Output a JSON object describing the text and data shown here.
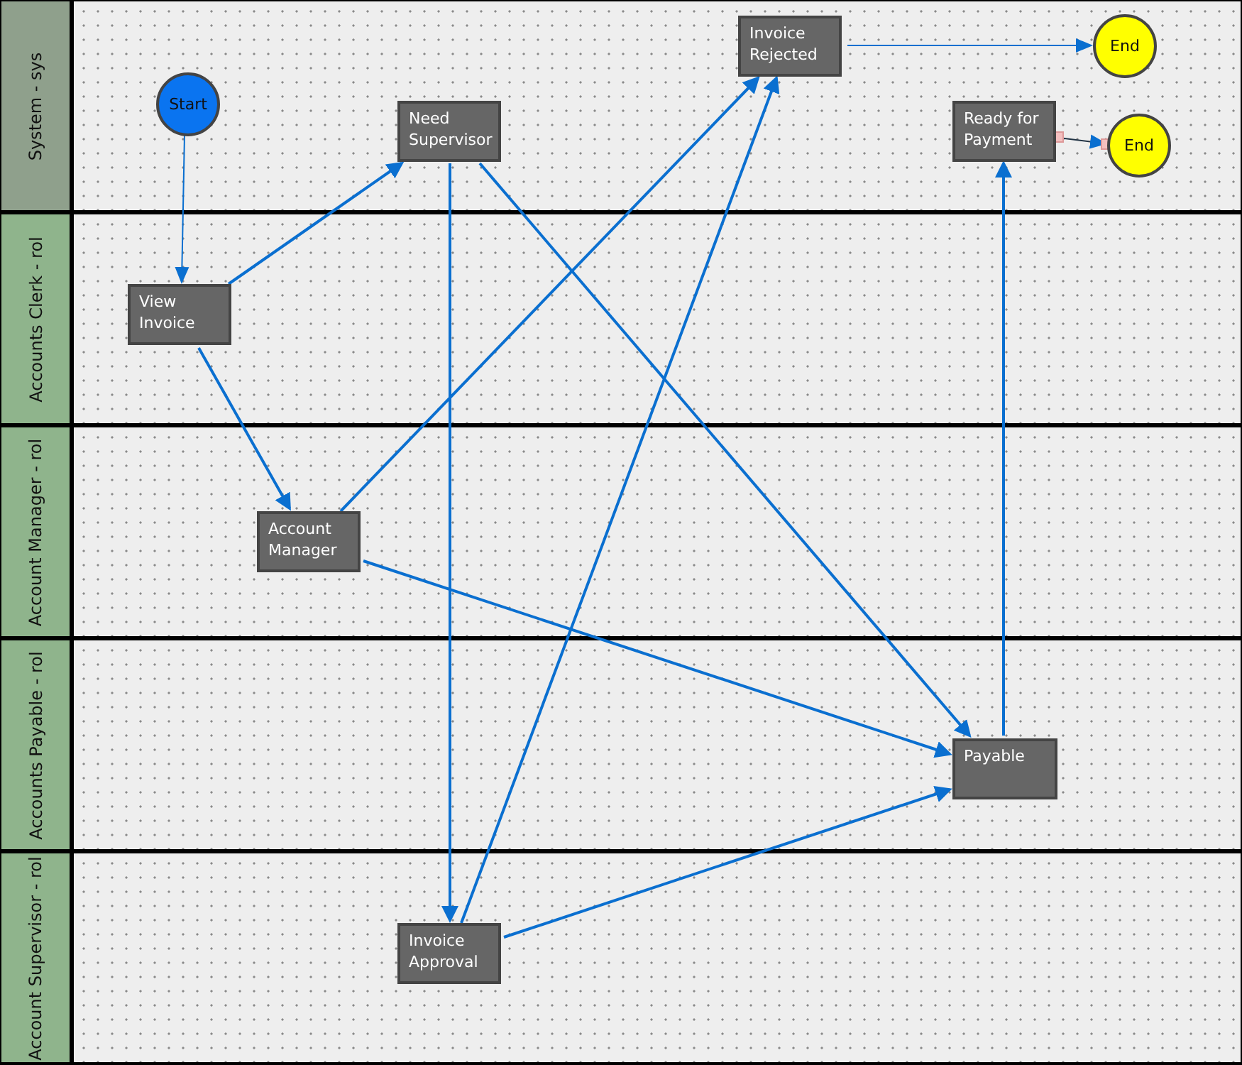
{
  "lanes": [
    {
      "label": "System - sys"
    },
    {
      "label": "Accounts Clerk - rol"
    },
    {
      "label": "Account Manager - rol"
    },
    {
      "label": "Accounts Payable - rol"
    },
    {
      "label": "Account Supervisor - rol"
    }
  ],
  "nodes": [
    {
      "kind": "start",
      "label": "Start"
    },
    {
      "kind": "task",
      "label": "Need Supervisor"
    },
    {
      "kind": "task",
      "label": "Invoice Rejected"
    },
    {
      "kind": "end",
      "label": "End"
    },
    {
      "kind": "task",
      "label": "Ready for Payment"
    },
    {
      "kind": "end",
      "label": "End"
    },
    {
      "kind": "task",
      "label": "View Invoice"
    },
    {
      "kind": "task",
      "label": "Account Manager"
    },
    {
      "kind": "task",
      "label": "Payable"
    },
    {
      "kind": "task",
      "label": "Invoice Approval"
    }
  ]
}
